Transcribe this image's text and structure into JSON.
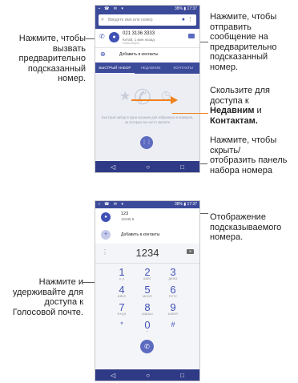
{
  "screen1": {
    "search_placeholder": "Введите имя или номер",
    "suggested": {
      "number": "021 3136 3333",
      "detail": "Китай, 1 мин назад",
      "sub": "Новосибирск"
    },
    "add_contact": "Добавить в контакты",
    "tabs": [
      "БЫСТРЫЙ НАБОР",
      "НЕДАВНИЕ",
      "КОНТАКТЫ"
    ],
    "empty_text": "Быстрый набор в одно касание для избранных и номеров, на которые вы часто звоните"
  },
  "screen2": {
    "contact_name": "123",
    "contact_number": "12345 6",
    "add_contact": "Добавить в контакты",
    "typed_number": "1234",
    "keys": [
      {
        "digit": "1",
        "letters": "o_o"
      },
      {
        "digit": "2",
        "letters": "АБВГ"
      },
      {
        "digit": "3",
        "letters": "ДЕЖЗ"
      },
      {
        "digit": "4",
        "letters": "ИЙКЛ"
      },
      {
        "digit": "5",
        "letters": "МНОП"
      },
      {
        "digit": "6",
        "letters": "РСТУ"
      },
      {
        "digit": "7",
        "letters": "ФХЦЧ"
      },
      {
        "digit": "8",
        "letters": "ШЩЪЫ"
      },
      {
        "digit": "9",
        "letters": "ЬЭЮЯ"
      },
      {
        "digit": "*",
        "letters": ""
      },
      {
        "digit": "0",
        "letters": "+"
      },
      {
        "digit": "#",
        "letters": ""
      }
    ]
  },
  "status_time": "17:37",
  "status_battery": "38%",
  "callouts": {
    "left_top": "Нажмите, чтобы вызвать предварительно подсказанный номер.",
    "right_top": "Нажмите, чтобы отправить сообщение на предварительно подсказанный номер.",
    "swipe_prefix": "Скользите для доступа к",
    "swipe_recent": "Недавним",
    "swipe_and": " и",
    "swipe_contacts": "Контактам.",
    "dialpad_toggle": "Нажмите, чтобы скрыть/ отобразить панель набора номера",
    "suggested_display": "Отображение подсказываемого номера.",
    "voicemail": "Нажмите и удерживайте для доступа к Голосовой почте."
  },
  "colors": {
    "statusbar": "#3c4a9a",
    "navbar": "#2f3a86",
    "accent": "#3f51b5",
    "orange": "#f0821e",
    "callout_line": "#5d5d5d"
  }
}
